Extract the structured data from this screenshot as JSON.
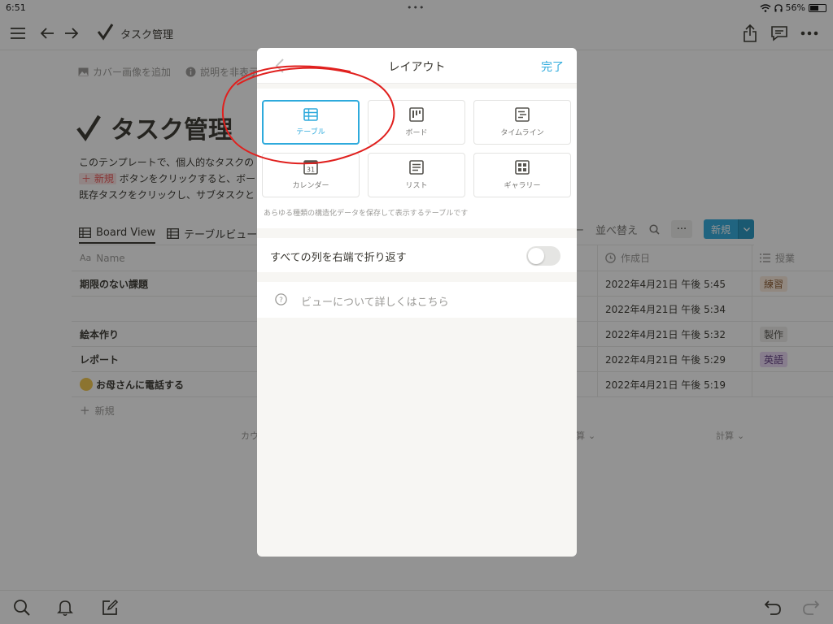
{
  "status_bar": {
    "time": "6:51",
    "battery": "56%",
    "battery_level": 0.56,
    "dots": "•••"
  },
  "topbar": {
    "title": "タスク管理"
  },
  "page": {
    "add_cover": "カバー画像を追加",
    "hide_description": "説明を非表示",
    "title": "タスク管理",
    "description": {
      "line1": "このテンプレートで、個人的なタスクの",
      "line2_tag": "＋ 新規",
      "line2_rest": "ボタンをクリックすると、ボー",
      "line3": "既存タスクをクリックし、サブタスクと"
    }
  },
  "view_tabs": {
    "tabs": [
      {
        "label": "Board View"
      },
      {
        "label": "テーブルビュー"
      }
    ],
    "filter": "ター",
    "sort": "並べ替え",
    "more": "···",
    "new_button": "新規"
  },
  "table": {
    "headers": {
      "name": "Name",
      "date": "作成日",
      "class": "授業"
    },
    "rows": [
      {
        "name": "期限のない課題",
        "date": "2022年4月21日 午後 5:45",
        "tag": "練習",
        "tag_color": "#fbecdd",
        "tag_text_color": "#8c5a30"
      },
      {
        "name": "",
        "date": "2022年4月21日 午後 5:34",
        "tag": "",
        "tag_color": "",
        "tag_text_color": ""
      },
      {
        "name": "絵本作り",
        "date": "2022年4月21日 午後 5:32",
        "tag": "製作",
        "tag_color": "#eeedeb",
        "tag_text_color": "#55534e"
      },
      {
        "name": "レポート",
        "date": "2022年4月21日 午後 5:29",
        "tag": "英語",
        "tag_color": "#ead7f5",
        "tag_text_color": "#5f3b80"
      },
      {
        "name": "お母さんに電話する",
        "date": "2022年4月21日 午後 5:19",
        "tag": "",
        "tag_color": "",
        "tag_text_color": ""
      }
    ],
    "add_new": "新規",
    "calc_left": "カウ",
    "calc_mid": "算",
    "calc_right": "計算"
  },
  "modal": {
    "title": "レイアウト",
    "done": "完了",
    "layouts": [
      {
        "label": "テーブル",
        "icon": "table-icon",
        "selected": true
      },
      {
        "label": "ボード",
        "icon": "board-icon",
        "selected": false
      },
      {
        "label": "タイムライン",
        "icon": "timeline-icon",
        "selected": false
      },
      {
        "label": "カレンダー",
        "icon": "calendar-icon",
        "selected": false
      },
      {
        "label": "リスト",
        "icon": "list-icon",
        "selected": false
      },
      {
        "label": "ギャラリー",
        "icon": "gallery-icon",
        "selected": false
      }
    ],
    "layout_description": "あらゆる種類の構造化データを保存して表示するテーブルです",
    "wrap_label": "すべての列を右端で折り返す",
    "wrap_enabled": false,
    "help_label": "ビューについて詳しくはこちら"
  },
  "colors": {
    "accent": "#2eaadc",
    "annotation": "#e0201e",
    "overlay": "rgba(15,15,15,0.45)"
  }
}
